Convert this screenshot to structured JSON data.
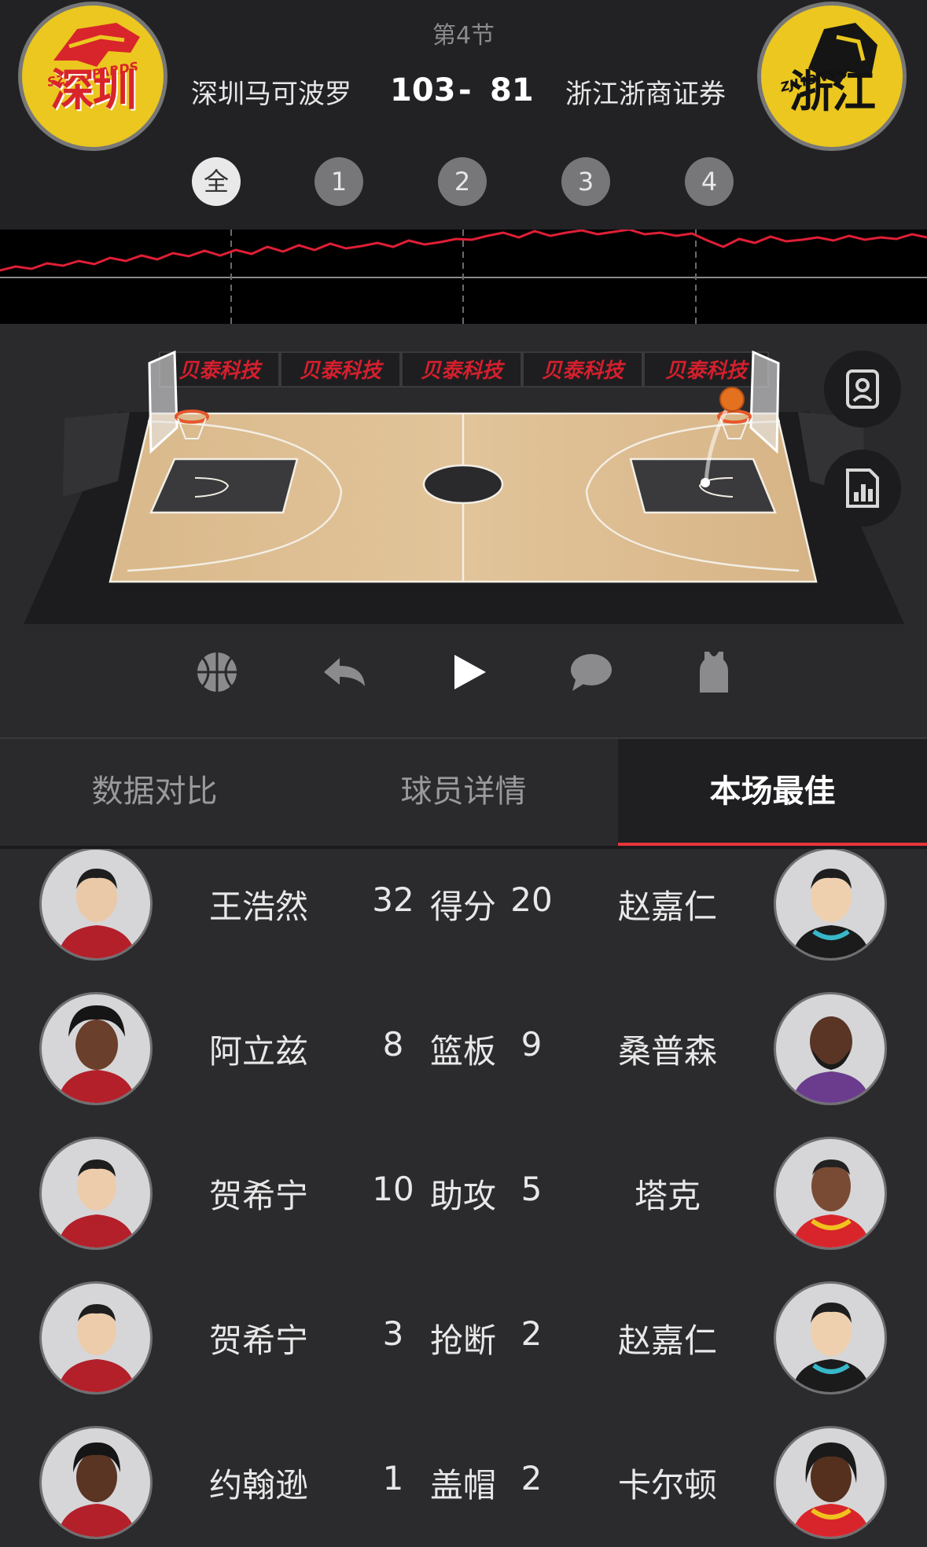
{
  "header": {
    "period": "第4节",
    "home": {
      "name": "深圳马可波罗",
      "score": "103",
      "logo_city": "深圳",
      "logo_tag": "SZLEOPARDS"
    },
    "away": {
      "name": "浙江浙商证券",
      "score": "81",
      "logo_city": "浙江",
      "logo_tag": "ZJLIONS"
    },
    "score_separator": "-",
    "quarters": [
      "全",
      "1",
      "2",
      "3",
      "4"
    ],
    "active_quarter": "全"
  },
  "court": {
    "sponsor_banners": [
      "贝泰科技",
      "贝泰科技",
      "贝泰科技",
      "贝泰科技",
      "贝泰科技"
    ],
    "side_buttons": [
      "player-card-icon",
      "stats-chart-icon"
    ]
  },
  "controls": [
    "basketball-icon",
    "replay-icon",
    "play-icon",
    "comment-icon",
    "jersey-icon"
  ],
  "tabs": [
    {
      "label": "数据对比",
      "active": false
    },
    {
      "label": "球员详情",
      "active": false
    },
    {
      "label": "本场最佳",
      "active": true
    }
  ],
  "leaders": [
    {
      "home_player": "王浩然",
      "home_value": "32",
      "category": "得分",
      "away_value": "20",
      "away_player": "赵嘉仁"
    },
    {
      "home_player": "阿立兹",
      "home_value": "8",
      "category": "篮板",
      "away_value": "9",
      "away_player": "桑普森"
    },
    {
      "home_player": "贺希宁",
      "home_value": "10",
      "category": "助攻",
      "away_value": "5",
      "away_player": "塔克"
    },
    {
      "home_player": "贺希宁",
      "home_value": "3",
      "category": "抢断",
      "away_value": "2",
      "away_player": "赵嘉仁"
    },
    {
      "home_player": "约翰逊",
      "home_value": "1",
      "category": "盖帽",
      "away_value": "2",
      "away_player": "卡尔顿"
    }
  ],
  "colors": {
    "accent": "#e6353a",
    "home_logo_bg": "#ebc71f",
    "home_logo_fg": "#d8252b",
    "away_logo_bg": "#ebc71f",
    "background": "#2b2b2e"
  }
}
